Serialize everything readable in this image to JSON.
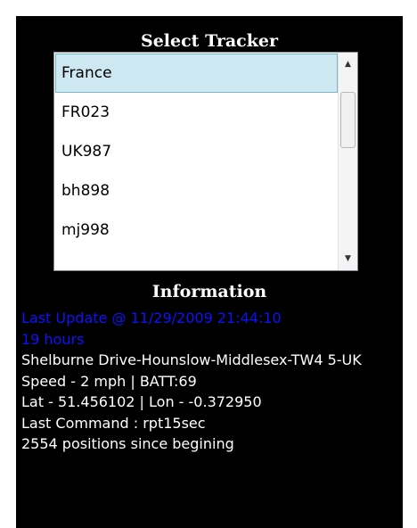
{
  "tracker_panel": {
    "title": "Select Tracker",
    "items": [
      {
        "label": "France",
        "selected": true
      },
      {
        "label": "FR023"
      },
      {
        "label": "UK987"
      },
      {
        "label": "bh898"
      },
      {
        "label": "mj998"
      }
    ]
  },
  "info_panel": {
    "title": "Information",
    "last_update": "Last Update @ 11/29/2009 21:44:10",
    "age": "19 hours",
    "address": "Shelburne Drive-Hounslow-Middlesex-TW4 5-UK",
    "speed_batt": "Speed - 2 mph | BATT:69",
    "lat_lon": "Lat - 51.456102 | Lon - -0.372950",
    "last_command": "Last Command : rpt15sec",
    "positions": "2554 positions since begining"
  },
  "icons": {
    "scroll_up": "triangle-up",
    "scroll_down": "triangle-down"
  },
  "colors": {
    "background": "#000000",
    "text": "#ffffff",
    "highlight_text": "#1010ff",
    "selection": "#cde8f0"
  }
}
